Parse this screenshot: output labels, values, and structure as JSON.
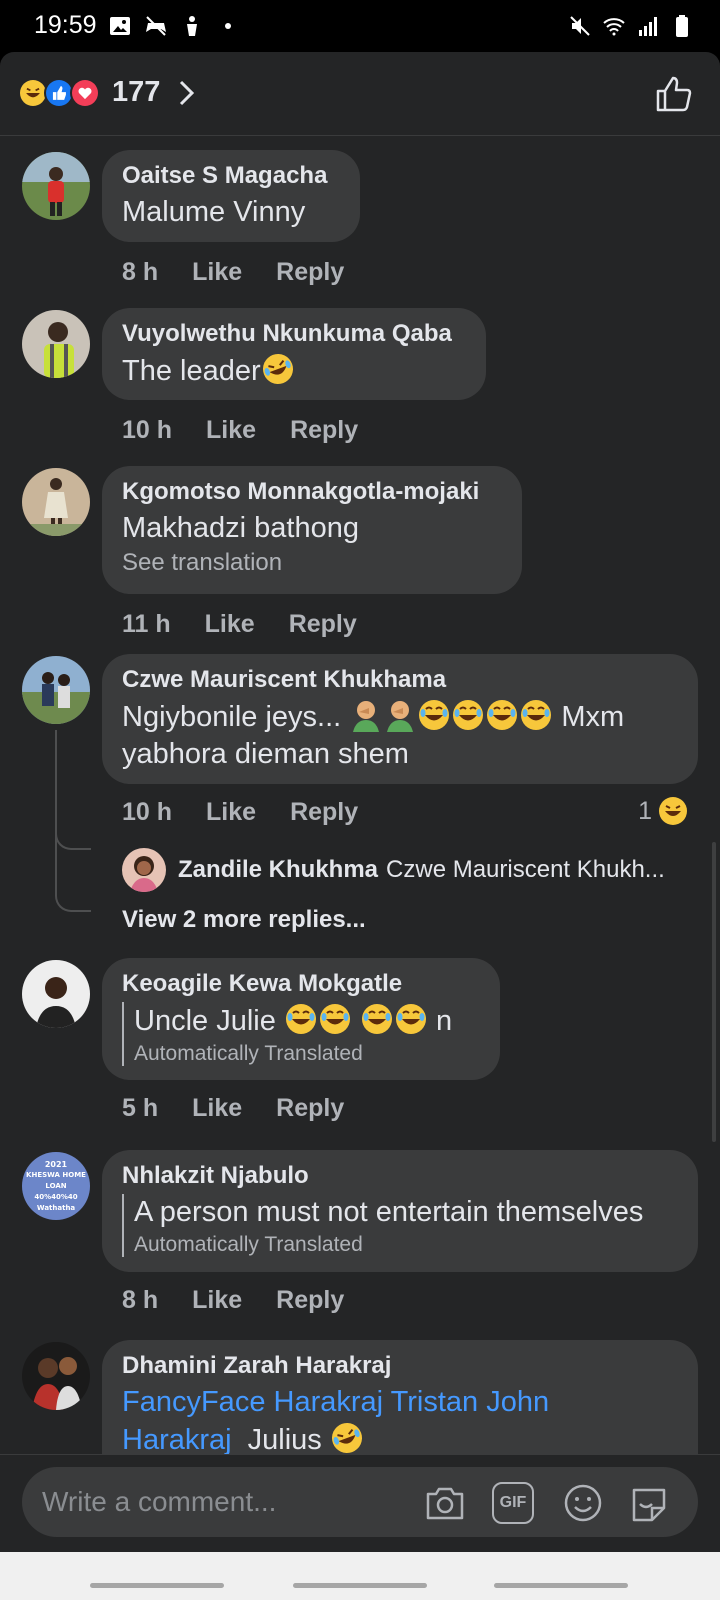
{
  "status_bar": {
    "time": "19:59"
  },
  "reactions": {
    "count": "177"
  },
  "comments": [
    {
      "name": "Oaitse S Magacha",
      "text": "Malume Vinny",
      "time": "8 h",
      "like": "Like",
      "reply": "Reply"
    },
    {
      "name": "Vuyolwethu Nkunkuma Qaba",
      "text": "The leader",
      "time": "10 h",
      "like": "Like",
      "reply": "Reply"
    },
    {
      "name": "Kgomotso Monnakgotla-mojaki",
      "text": "Makhadzi bathong",
      "see_translation": "See translation",
      "time": "11 h",
      "like": "Like",
      "reply": "Reply"
    },
    {
      "name": "Czwe Mauriscent Khukhama",
      "text_line1": "Ngiybonile jeys...",
      "text_line1_end": "Mxm",
      "text_line2": "yabhora dieman shem",
      "time": "10 h",
      "like": "Like",
      "reply": "Reply",
      "reaction_count": "1"
    },
    {
      "name": "Keoagile Kewa Mokgatle",
      "text": "Uncle Julie",
      "text_end": "n",
      "translated_note": "Automatically Translated",
      "time": "5 h",
      "like": "Like",
      "reply": "Reply"
    },
    {
      "name": "Nhlakzit Njabulo",
      "text": "A person must not entertain themselves",
      "translated_note": "Automatically Translated",
      "avatar_text": [
        "2021",
        "KHESWA HOME",
        "LOAN",
        "40%40%40",
        "Wathatha"
      ],
      "time": "8 h",
      "like": "Like",
      "reply": "Reply"
    },
    {
      "name": "Dhamini Zarah Harakraj",
      "mention_1": "FancyFace Harakraj Tristan John",
      "mention_2": "Harakraj",
      "text_end": "Julius"
    }
  ],
  "thread": {
    "reply_name": "Zandile Khukhma",
    "reply_text": "Czwe Mauriscent Khukh...",
    "view_more": "View 2 more replies..."
  },
  "composer": {
    "placeholder": "Write a comment...",
    "gif_label": "GIF"
  },
  "colors": {
    "background": "#242526",
    "bubble": "#3a3b3c",
    "mention": "#4599ff",
    "muted": "#b0b3b8"
  }
}
